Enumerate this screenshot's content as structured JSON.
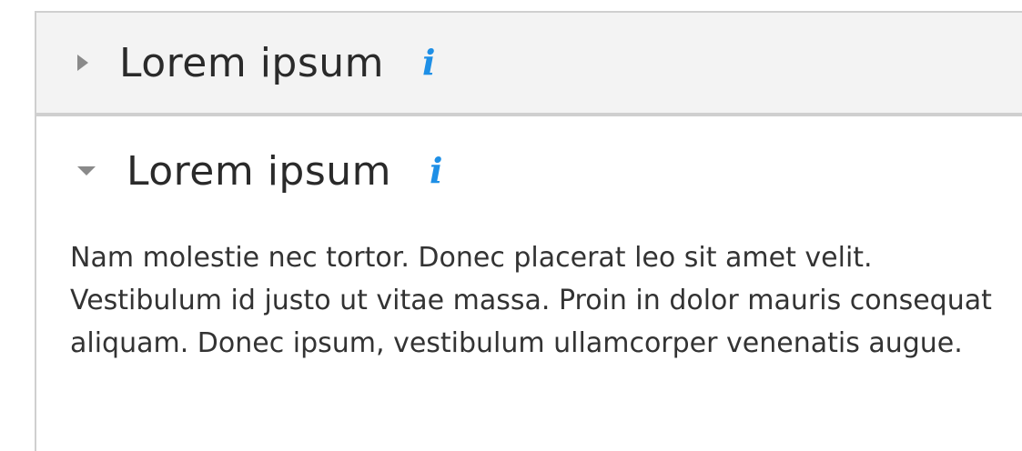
{
  "accordion": {
    "panels": [
      {
        "title": "Lorem ipsum",
        "expanded": false,
        "chevron_icon": "chevron-right-icon",
        "info_icon": "info-icon",
        "info_glyph": "i"
      },
      {
        "title": "Lorem ipsum",
        "expanded": true,
        "chevron_icon": "chevron-down-icon",
        "info_icon": "info-icon",
        "info_glyph": "i",
        "body": "Nam molestie nec tortor. Donec placerat leo sit amet velit. Vestibulum id justo ut vitae massa. Proin in dolor mauris consequat aliquam. Donec ipsum, vestibulum ullamcorper venenatis augue."
      }
    ]
  },
  "colors": {
    "accent": "#1e8fe6",
    "header_background": "#f3f3f3",
    "border": "#cfcfcf",
    "text": "#333333"
  }
}
